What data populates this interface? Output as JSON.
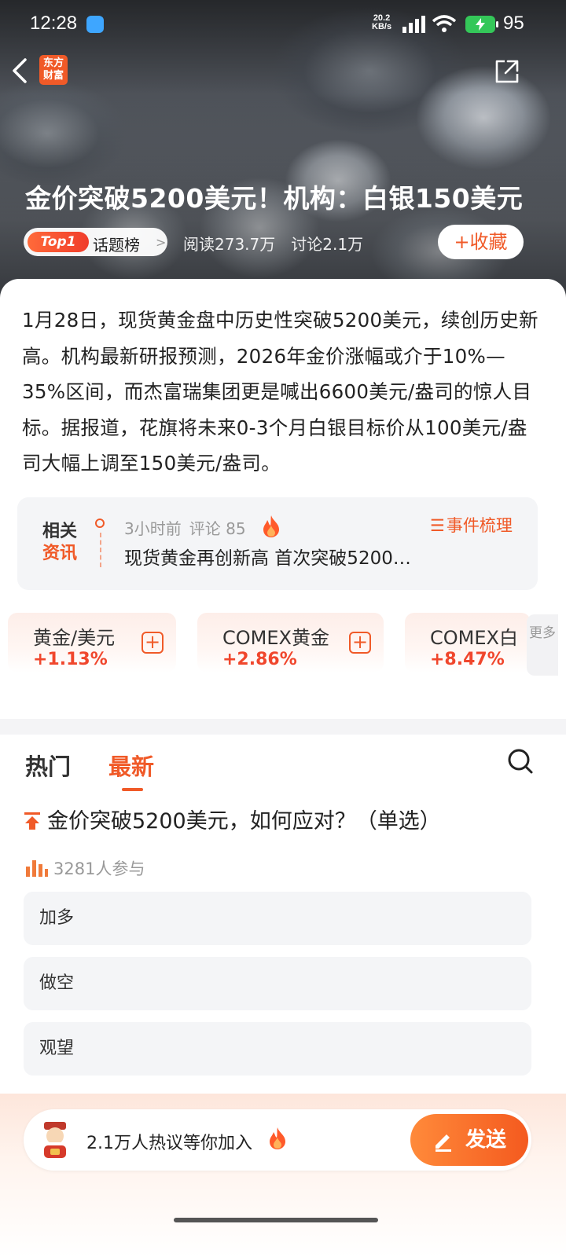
{
  "status_bar": {
    "time": "12:28",
    "net_speed_value": "20.2",
    "net_speed_unit": "KB/s",
    "battery": "95"
  },
  "header": {
    "logo_line1": "东方",
    "logo_line2": "财富"
  },
  "hero": {
    "title": "金价突破5200美元！机构：白银150美元",
    "topic_badge": "Top1",
    "topic_label": "话题榜",
    "reads": "阅读273.7万",
    "discussions": "讨论2.1万",
    "favorite_label": "+收藏"
  },
  "summary": "1月28日，现货黄金盘中历史性突破5200美元，续创历史新高。机构最新研报预测，2026年金价涨幅或介于10%—35%区间，而杰富瑞集团更是喊出6600美元/盎司的惊人目标。据报道，花旗将未来0-3个月白银目标价从100美元/盎司大幅上调至150美元/盎司。",
  "related": {
    "tag_line1": "相关",
    "tag_line2": "资讯",
    "time_ago": "3小时前",
    "comments": "评论 85",
    "event_label": "事件梳理",
    "headline": "现货黄金再创新高 首次突破5200…"
  },
  "quotes": [
    {
      "name": "黄金/美元",
      "change": "+1.13%"
    },
    {
      "name": "COMEX黄金",
      "change": "+2.86%"
    },
    {
      "name": "COMEX白",
      "change": "+8.47%"
    }
  ],
  "quotes_more": "更多",
  "feed_tabs": {
    "hot": "热门",
    "latest": "最新"
  },
  "poll": {
    "title": "金价突破5200美元，如何应对？（单选）",
    "participants": "3281人参与",
    "options": [
      "加多",
      "做空",
      "观望"
    ]
  },
  "bottom_bar": {
    "invite_text": "2.1万人热议等你加入",
    "send_label": "发送"
  },
  "colors": {
    "accent": "#f05a28",
    "rise": "#f0462c"
  }
}
